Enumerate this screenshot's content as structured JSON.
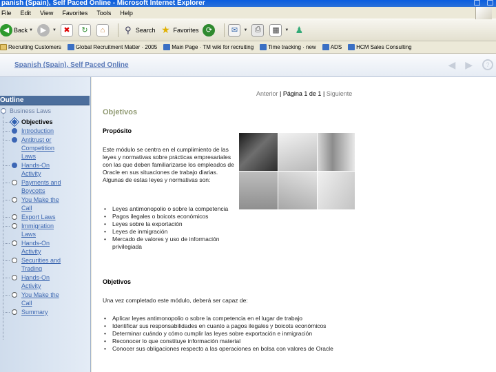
{
  "window": {
    "title": "panish (Spain), Self Paced Online - Microsoft Internet Explorer"
  },
  "menu": [
    "File",
    "Edit",
    "View",
    "Favorites",
    "Tools",
    "Help"
  ],
  "toolbar": {
    "back_label": "Back",
    "search_label": "Search",
    "favorites_label": "Favorites"
  },
  "links": [
    "Recruiting Customers",
    "Global Recruitment Matter · 2005",
    "Main Page · TM wiki for recruiting",
    "Time tracking · new",
    "ADS",
    "HCM Sales Consulting"
  ],
  "app": {
    "title": "Spanish (Spain), Self Paced Online"
  },
  "sidebar": {
    "header": "Outline",
    "root": "Business Laws",
    "items": [
      {
        "label": "Objectives",
        "state": "active"
      },
      {
        "label": "Introduction",
        "state": "filled"
      },
      {
        "label": "Antitrust or Competition Laws",
        "state": "filled"
      },
      {
        "label": "Hands-On Activity",
        "state": "filled"
      },
      {
        "label": "Payments and Boycotts",
        "state": "open"
      },
      {
        "label": "You Make the Call",
        "state": "open"
      },
      {
        "label": "Export Laws",
        "state": "open"
      },
      {
        "label": "Immigration Laws",
        "state": "open"
      },
      {
        "label": "Hands-On Activity",
        "state": "open"
      },
      {
        "label": "Securities and Trading",
        "state": "open"
      },
      {
        "label": "Hands-On Activity",
        "state": "open"
      },
      {
        "label": "You Make the Call",
        "state": "open"
      },
      {
        "label": "Summary",
        "state": "open"
      }
    ]
  },
  "pager": {
    "prev": "Anterior",
    "page": "Página 1 de 1",
    "next": "Siguiente"
  },
  "content": {
    "section_title": "Objetivos",
    "purpose_heading": "Propósito",
    "purpose_text": "Este módulo se centra en el cumplimiento de las leyes y normativas sobre prácticas empresariales con las que deben familiarizarse los empleados de Oracle en sus situaciones de trabajo diarias. Algunas de estas leyes y normativas son:",
    "laws": [
      "Leyes antimonopolio o sobre la competencia",
      "Pagos ilegales o boicots económicos",
      "Leyes sobre la exportación",
      "Leyes de inmigración",
      "Mercado de valores y uso de información privilegiada"
    ],
    "objectives_heading": "Objetivos",
    "objectives_intro": "Una vez completado este módulo, deberá ser capaz de:",
    "objectives": [
      "Aplicar leyes antimonopolio o sobre la competencia en el lugar de trabajo",
      "Identificar sus responsabilidades en cuanto a pagos ilegales y boicots económicos",
      "Determinar cuándo y cómo cumplir las leyes sobre exportación e inmigración",
      "Reconocer lo que constituye información material",
      "Conocer sus obligaciones respecto a las operaciones en bolsa con valores de Oracle"
    ]
  }
}
